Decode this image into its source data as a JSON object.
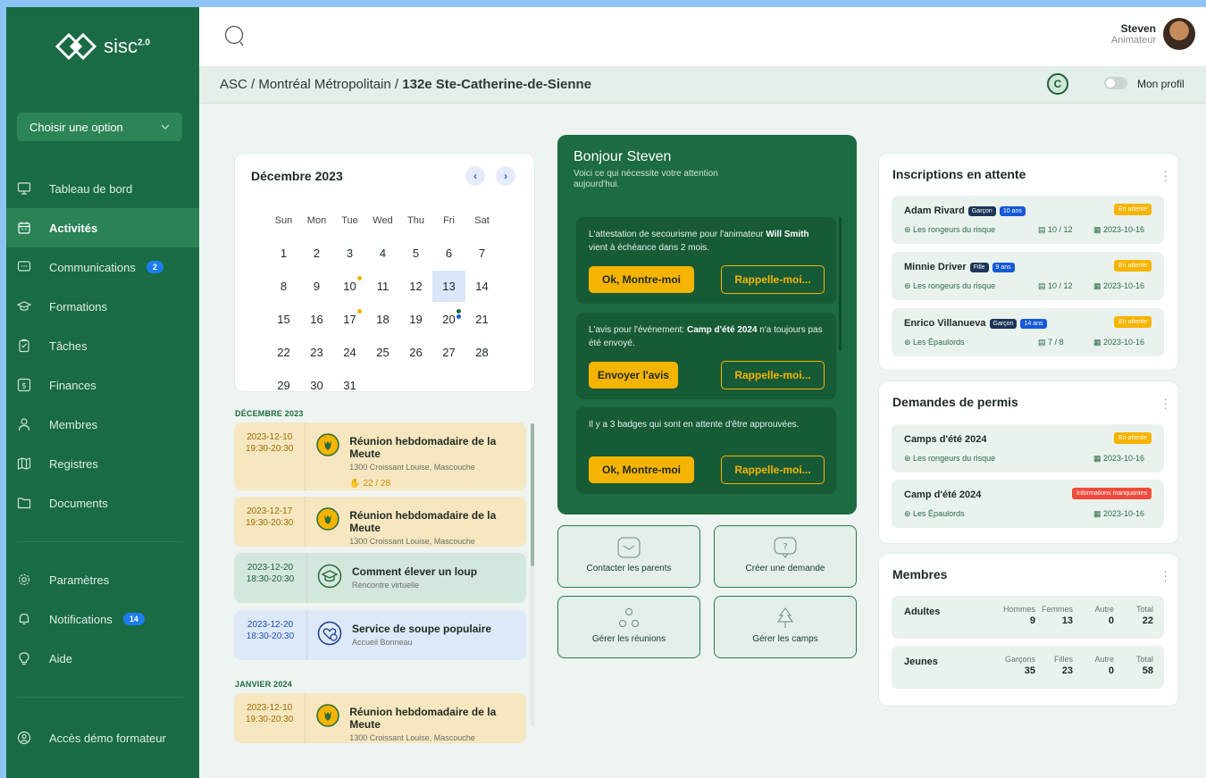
{
  "sidebar": {
    "brand": "sisc",
    "brand_version": "2.0",
    "choose_option": "Choisir une option",
    "items": [
      {
        "label": "Tableau de bord",
        "icon": "monitor-icon"
      },
      {
        "label": "Activités",
        "icon": "calendar-icon",
        "active": true
      },
      {
        "label": "Communications",
        "icon": "chat-icon",
        "badge": "2"
      },
      {
        "label": "Formations",
        "icon": "graduation-icon"
      },
      {
        "label": "Tâches",
        "icon": "clipboard-icon"
      },
      {
        "label": "Finances",
        "icon": "dollar-icon"
      },
      {
        "label": "Membres",
        "icon": "user-icon"
      },
      {
        "label": "Registres",
        "icon": "map-icon"
      },
      {
        "label": "Documents",
        "icon": "folder-icon"
      }
    ],
    "bottom_items": [
      {
        "label": "Paramètres",
        "icon": "gear-icon"
      },
      {
        "label": "Notifications",
        "icon": "bell-icon",
        "badge": "14"
      },
      {
        "label": "Aide",
        "icon": "lightbulb-icon"
      }
    ],
    "trainer_demo": "Accès démo formateur"
  },
  "topbar": {
    "user_name": "Steven",
    "user_role": "Animateur"
  },
  "breadcrumb": {
    "part1": "ASC / Montréal Métropolitain / ",
    "current": "132e Ste-Catherine-de-Sienne",
    "c_button": "C",
    "profile_toggle": "Mon profil"
  },
  "calendar": {
    "title": "Décembre 2023",
    "prev": "‹",
    "next": "›",
    "weekdays": [
      "Sun",
      "Mon",
      "Tue",
      "Wed",
      "Thu",
      "Fri",
      "Sat"
    ],
    "weeks": [
      [
        "1",
        "2",
        "3",
        "4",
        "5",
        "6",
        "7"
      ],
      [
        "8",
        "9",
        "10",
        "11",
        "12",
        "13",
        "14"
      ],
      [
        "15",
        "16",
        "17",
        "18",
        "19",
        "20",
        "21"
      ],
      [
        "22",
        "23",
        "24",
        "25",
        "26",
        "27",
        "28"
      ],
      [
        "29",
        "30",
        "31",
        "",
        "",
        "",
        ""
      ]
    ],
    "today": "13"
  },
  "events": {
    "section_dec": "DÉCEMBRE 2023",
    "section_jan": "JANVIER 2024",
    "items": [
      {
        "date": "2023-12-10",
        "time": "19:30-20:30",
        "title": "Réunion hebdomadaire de la Meute",
        "sub": "1300 Croissant Louise, Mascouche",
        "count": "22 / 28"
      },
      {
        "date": "2023-12-17",
        "time": "19:30-20:30",
        "title": "Réunion hebdomadaire de la Meute",
        "sub": "1300 Croissant Louise, Mascouche"
      },
      {
        "date": "2023-12-20",
        "time": "18:30-20:30",
        "title": "Comment élever un loup",
        "sub": "Rencontre virtuelle"
      },
      {
        "date": "2023-12-20",
        "time": "18:30-20:30",
        "title": "Service de soupe populaire",
        "sub": "Accueil Bonneau"
      },
      {
        "date": "2023-12-10",
        "time": "19:30-20:30",
        "title": "Réunion hebdomadaire de la Meute",
        "sub": "1300 Croissant Louise, Mascouche"
      }
    ]
  },
  "greeting": {
    "title": "Bonjour Steven",
    "subtitle": "Voici ce qui nécessite votre attention aujourd'hui.",
    "tasks": [
      {
        "pre": "L'attestation de secourisme pour l'animateur ",
        "bold": "Will Smith",
        "post": " vient à échéance dans 2 mois.",
        "primary": "Ok, Montre-moi",
        "secondary": "Rappelle-moi..."
      },
      {
        "pre": "L'avis pour l'événement: ",
        "bold": "Camp d'été 2024",
        "post": " n'a toujours pas été envoyé.",
        "primary": "Envoyer l'avis",
        "secondary": "Rappelle-moi..."
      },
      {
        "pre": "Il y a 3 badges qui sont en attente d'être approuvées.",
        "bold": "",
        "post": "",
        "primary": "Ok, Montre-moi",
        "secondary": "Rappelle-moi..."
      }
    ]
  },
  "quick_actions": [
    "Contacter les parents",
    "Créer une demande",
    "Gérer les réunions",
    "Gérer les camps"
  ],
  "registrations": {
    "title": "Inscriptions en attente",
    "items": [
      {
        "name": "Adam Rivard",
        "gender": "Garçon",
        "age": "10 ans",
        "status": "En attente",
        "unit": "Les rongeurs du risque",
        "count": "10 / 12",
        "date": "2023-10-16"
      },
      {
        "name": "Minnie Driver",
        "gender": "Fille",
        "age": "9 ans",
        "status": "En attente",
        "unit": "Les rongeurs du risque",
        "count": "10 / 12",
        "date": "2023-10-16"
      },
      {
        "name": "Enrico Villanueva",
        "gender": "Garçon",
        "age": "14 ans",
        "status": "En attente",
        "unit": "Les Épaulords",
        "count": "7 / 8",
        "date": "2023-10-16"
      }
    ]
  },
  "permits": {
    "title": "Demandes de permis",
    "items": [
      {
        "name": "Camps d'été 2024",
        "status": "En attente",
        "status_color": "#f5b400",
        "unit": "Les rongeurs du risque",
        "date": "2023-10-16"
      },
      {
        "name": "Camp d'été 2024",
        "status": "Informations manquantes",
        "status_color": "#f04b3a",
        "unit": "Les Épaulords",
        "date": "2023-10-16"
      }
    ]
  },
  "members": {
    "title": "Membres",
    "adults": {
      "label": "Adultes",
      "cols": [
        {
          "h": "Hommes",
          "v": "9"
        },
        {
          "h": "Femmes",
          "v": "13"
        },
        {
          "h": "Autre",
          "v": "0"
        },
        {
          "h": "Total",
          "v": "22"
        }
      ]
    },
    "youth": {
      "label": "Jeunes",
      "cols": [
        {
          "h": "Garçons",
          "v": "35"
        },
        {
          "h": "Filles",
          "v": "23"
        },
        {
          "h": "Autre",
          "v": "0"
        },
        {
          "h": "Total",
          "v": "58"
        }
      ]
    }
  }
}
